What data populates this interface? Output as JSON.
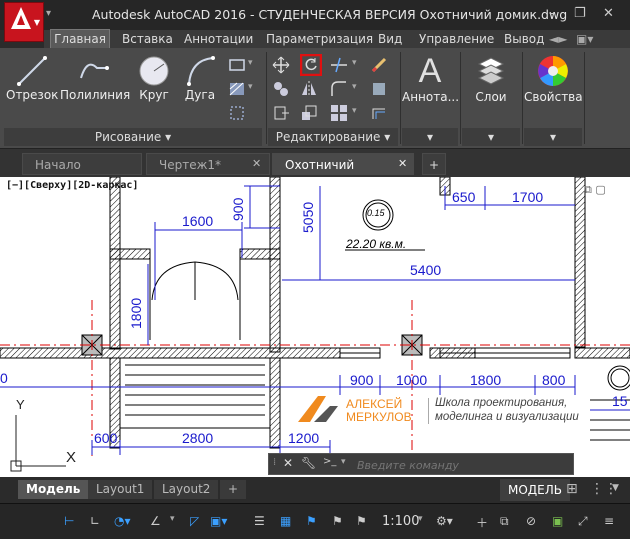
{
  "window": {
    "title": "Autodesk AutoCAD 2016 - СТУДЕНЧЕСКАЯ ВЕРСИЯ    Охотничий домик.dwg",
    "minimize": "–",
    "restore": "❐",
    "close": "✕"
  },
  "ribbon_tabs": [
    "Главная",
    "Вставка",
    "Аннотации",
    "Параметризация",
    "Вид",
    "Управление",
    "Вывод"
  ],
  "ribbon": {
    "draw": {
      "line": "Отрезок",
      "polyline": "Полилиния",
      "circle": "Круг",
      "arc": "Дуга",
      "panel_title": "Рисование ▾"
    },
    "modify": {
      "panel_title": "Редактирование ▾"
    },
    "annotation": "Аннота...",
    "layers": "Слои",
    "properties": "Свойства"
  },
  "doc_tabs": {
    "start": "Начало",
    "drawing1": "Чертеж1*",
    "current": "Охотничий домик*",
    "add": "+"
  },
  "viewport_label": "[−][Сверху][2D-каркас]",
  "drawing": {
    "dims": {
      "d1600": "1600",
      "d900": "900",
      "d5050": "5050",
      "d650": "650",
      "d1700": "1700",
      "d5400": "5400",
      "d1800v": "1800",
      "room_tag": "0.15",
      "area": "22.20 кв.м.",
      "d900b": "900",
      "d1000": "1000",
      "d1800b": "1800",
      "d800": "800",
      "d600": "600",
      "d2800": "2800",
      "d1200": "1200",
      "d15": "15",
      "d0": "0"
    },
    "ucs": {
      "y": "Y",
      "x": "X"
    }
  },
  "watermark": {
    "name1": "АЛЕКСЕЙ",
    "name2": "МЕРКУЛОВ",
    "school1": "Школа проектирования,",
    "school2": "моделинга и визуализации"
  },
  "command": {
    "placeholder": "Введите команду",
    "prompt": ">_"
  },
  "layout_tabs": {
    "model": "Модель",
    "layout1": "Layout1",
    "layout2": "Layout2",
    "add": "+"
  },
  "status": {
    "model_button": "МОДЕЛЬ",
    "scale": "1:100"
  },
  "colors": {
    "accent_red": "#c8141e",
    "dimension_blue": "#1a1acc",
    "centerline_red": "#dd0000",
    "highlight_box": "#e01010"
  }
}
